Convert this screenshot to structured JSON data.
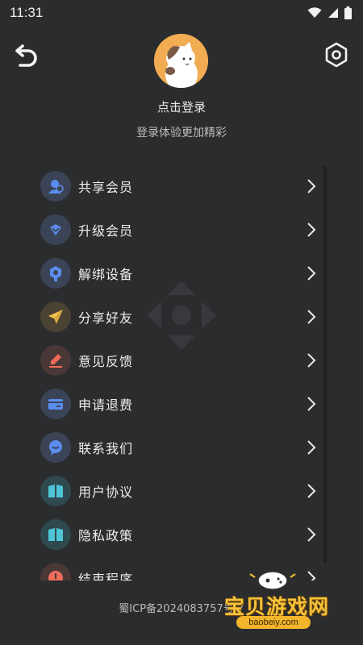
{
  "status_bar": {
    "time": "11:31"
  },
  "header": {
    "login_title": "点击登录",
    "login_subtitle": "登录体验更加精彩"
  },
  "menu": {
    "items": [
      {
        "label": "共享会员",
        "icon": "share-member-icon",
        "icon_color": "#5b8def"
      },
      {
        "label": "升级会员",
        "icon": "diamond-icon",
        "icon_color": "#5b8def"
      },
      {
        "label": "解绑设备",
        "icon": "unlink-device-icon",
        "icon_color": "#5b8def"
      },
      {
        "label": "分享好友",
        "icon": "paper-plane-icon",
        "icon_color": "#f2c14e"
      },
      {
        "label": "意见反馈",
        "icon": "pen-feedback-icon",
        "icon_color": "#ef6b5a"
      },
      {
        "label": "申请退费",
        "icon": "card-refund-icon",
        "icon_color": "#5b8def"
      },
      {
        "label": "联系我们",
        "icon": "chat-bubble-icon",
        "icon_color": "#5b8def"
      },
      {
        "label": "用户协议",
        "icon": "book-icon",
        "icon_color": "#4fc3d8"
      },
      {
        "label": "隐私政策",
        "icon": "book-icon",
        "icon_color": "#4fc3d8"
      },
      {
        "label": "结束程序",
        "icon": "power-icon",
        "icon_color": "#ef6b5a"
      }
    ]
  },
  "footer": {
    "icp": "蜀ICP备2024083757号-7"
  },
  "watermark": {
    "text": "宝贝游戏网",
    "url": "baobeiy.com"
  }
}
